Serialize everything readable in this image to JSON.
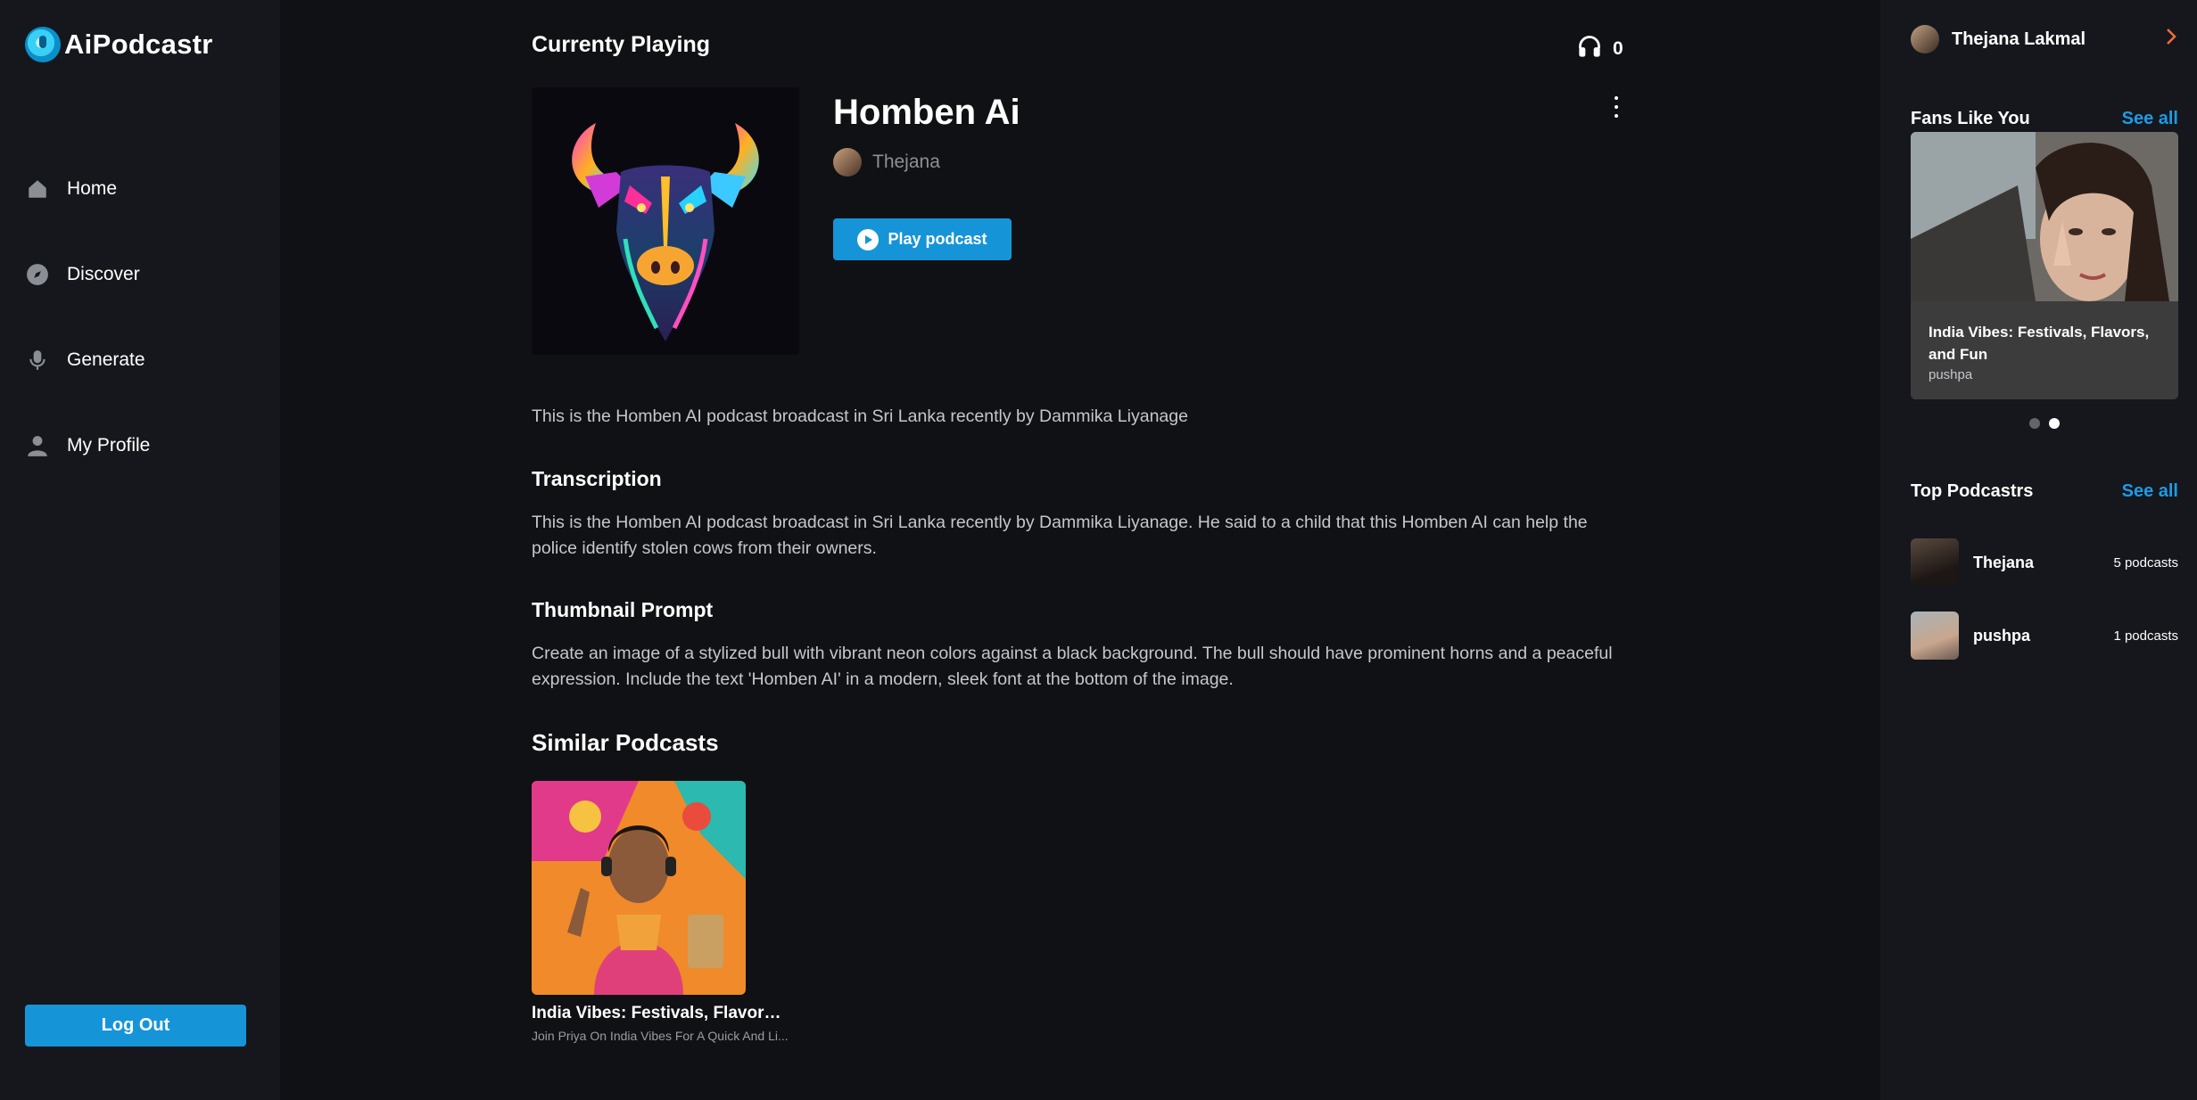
{
  "brand": {
    "name": "AiPodcastr"
  },
  "nav": {
    "items": [
      {
        "label": "Home",
        "icon": "home-icon"
      },
      {
        "label": "Discover",
        "icon": "compass-icon"
      },
      {
        "label": "Generate",
        "icon": "microphone-icon"
      },
      {
        "label": "My Profile",
        "icon": "user-icon"
      }
    ],
    "logout_label": "Log Out"
  },
  "main": {
    "currently_playing_label": "Currenty Playing",
    "listener_count": "0",
    "podcast": {
      "title": "Homben Ai",
      "author": "Thejana",
      "play_label": "Play podcast",
      "description": "This is the Homben AI podcast broadcast in Sri Lanka recently by Dammika Liyanage"
    },
    "transcription": {
      "heading": "Transcription",
      "text": "This is the Homben AI podcast broadcast in Sri Lanka recently by Dammika Liyanage. He said to a child that this Homben AI can help the police identify stolen cows from their owners."
    },
    "thumbnail_prompt": {
      "heading": "Thumbnail Prompt",
      "text": "Create an image of a stylized bull with vibrant neon colors against a black background. The bull should have prominent horns and a peaceful expression. Include the text 'Homben AI' in a modern, sleek font at the bottom of the image."
    },
    "similar": {
      "heading": "Similar Podcasts",
      "items": [
        {
          "title": "India Vibes: Festivals, Flavors,...",
          "subtitle": "Join Priya On India Vibes For A Quick And Li..."
        }
      ]
    }
  },
  "right": {
    "user_name": "Thejana Lakmal",
    "fans": {
      "heading": "Fans Like You",
      "see_all": "See all",
      "card_title": "India Vibes: Festivals, Flavors, and Fun",
      "card_author": "pushpa",
      "active_slide": 2,
      "slide_count": 2
    },
    "top_podcastrs": {
      "heading": "Top Podcastrs",
      "see_all": "See all",
      "items": [
        {
          "name": "Thejana",
          "count": "5 podcasts"
        },
        {
          "name": "pushpa",
          "count": "1 podcasts"
        }
      ]
    }
  },
  "colors": {
    "accent": "#1694d8",
    "link": "#1d9be6",
    "chevron": "#f26b3a",
    "background": "#101114",
    "panel": "#15171c"
  }
}
